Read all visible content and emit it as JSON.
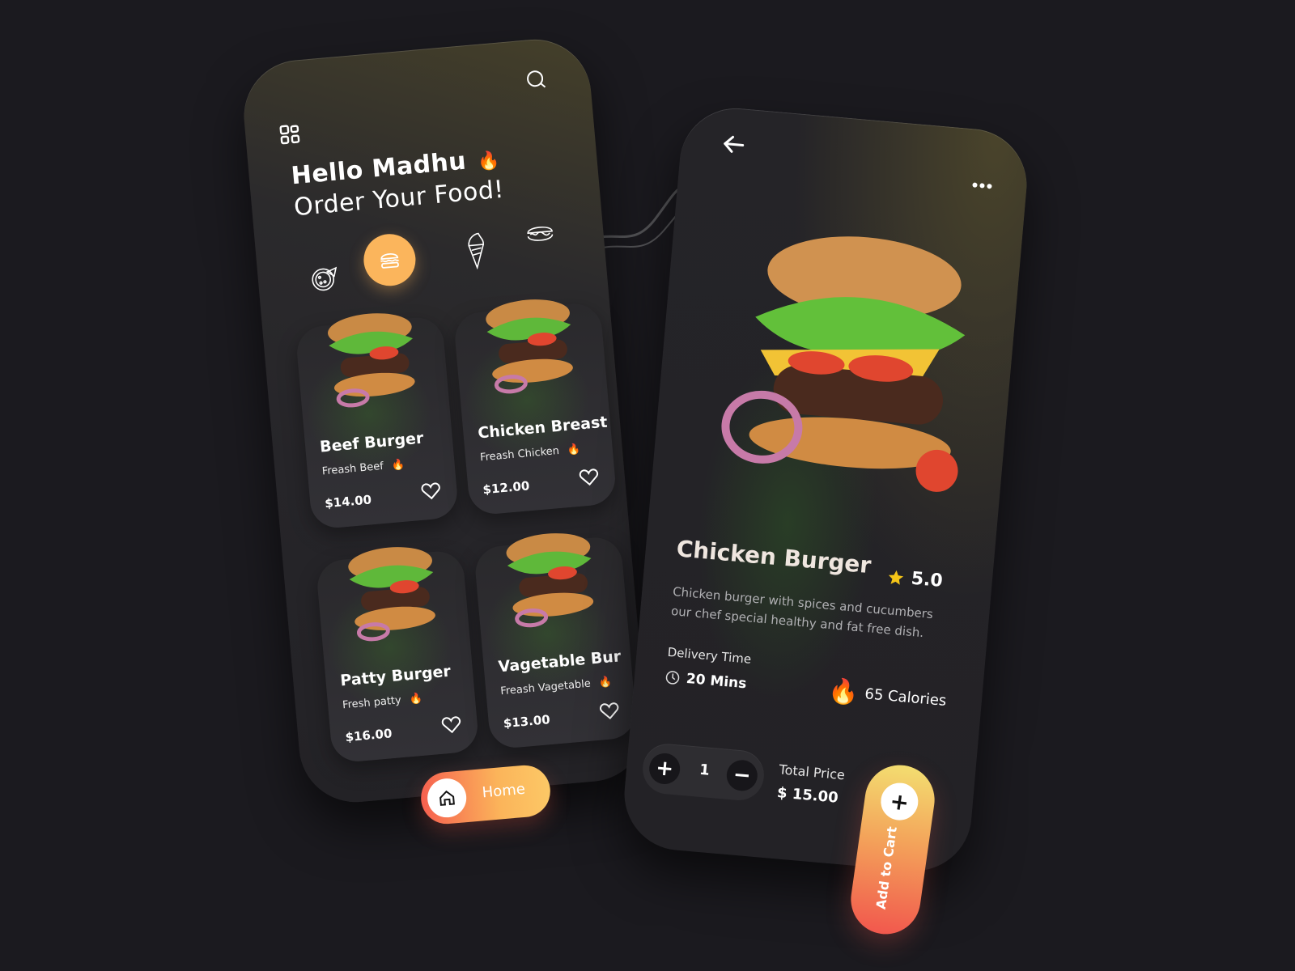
{
  "home": {
    "greeting_name": "Hello  Madhu",
    "greeting_sub": "Order Your Food!",
    "greeting_emoji": "🔥",
    "categories": [
      {
        "name": "pizza",
        "icon": "pizza-icon",
        "active": false
      },
      {
        "name": "burger",
        "icon": "burger-icon",
        "active": true
      },
      {
        "name": "ice-cream",
        "icon": "ice-cream-icon",
        "active": false
      },
      {
        "name": "hotdog",
        "icon": "hotdog-icon",
        "active": false
      }
    ],
    "items": [
      {
        "name": "Beef Burger",
        "subtitle": "Freash Beef",
        "price": "$14.00"
      },
      {
        "name": "Chicken Breast",
        "subtitle": "Freash Chicken",
        "price": "$12.00"
      },
      {
        "name": "Patty Burger",
        "subtitle": "Fresh patty",
        "price": "$16.00"
      },
      {
        "name": "Vagetable Bur",
        "subtitle": "Freash Vagetable",
        "price": "$13.00"
      }
    ],
    "fire_emoji": "🔥",
    "nav": {
      "home_label": "Home"
    }
  },
  "detail": {
    "title": "Chicken Burger",
    "rating": "5.0",
    "description": "Chicken burger with spices and cucumbers our chef special healthy and fat free dish.",
    "delivery_label": "Delivery Time",
    "delivery_value": "20 Mins",
    "calories": "65 Calories",
    "calories_emoji": "🔥",
    "quantity": "1",
    "plus": "+",
    "minus": "−",
    "total_label": "Total Price",
    "total_value": "$ 15.00",
    "add_to_cart_label": "Add to Cart"
  },
  "colors": {
    "background": "#1b1a1f",
    "accent_orange": "#fbb55c",
    "gradient_start": "#f6604f",
    "gradient_end": "#fcc866",
    "star": "#f5c518"
  }
}
